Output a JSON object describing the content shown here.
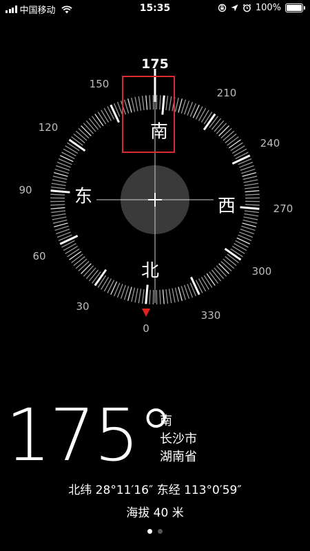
{
  "status_bar": {
    "carrier": "中国移动",
    "time": "15:35",
    "battery": "100%",
    "icons": [
      "signal-icon",
      "wifi-icon",
      "rotation-lock-icon",
      "location-arrow-icon",
      "alarm-icon",
      "battery-icon"
    ]
  },
  "compass": {
    "heading_indicator": "175",
    "degree_labels": [
      "0",
      "30",
      "60",
      "90",
      "120",
      "150",
      "210",
      "240",
      "270",
      "300",
      "330"
    ],
    "directions": {
      "north": "北",
      "east": "东",
      "south": "南",
      "west": "西"
    },
    "heading_degrees": 175
  },
  "readout": {
    "heading": "175°",
    "direction": "南",
    "city": "长沙市",
    "province": "湖南省",
    "coordinates": "北纬 28°11′16″  东经 113°0′59″",
    "altitude": "海拔 40 米"
  },
  "pagination": {
    "current": 1,
    "total": 2
  },
  "colors": {
    "accent_red": "#e0231c",
    "background": "#000000",
    "text": "#ffffff",
    "muted": "#bdbdbd"
  }
}
